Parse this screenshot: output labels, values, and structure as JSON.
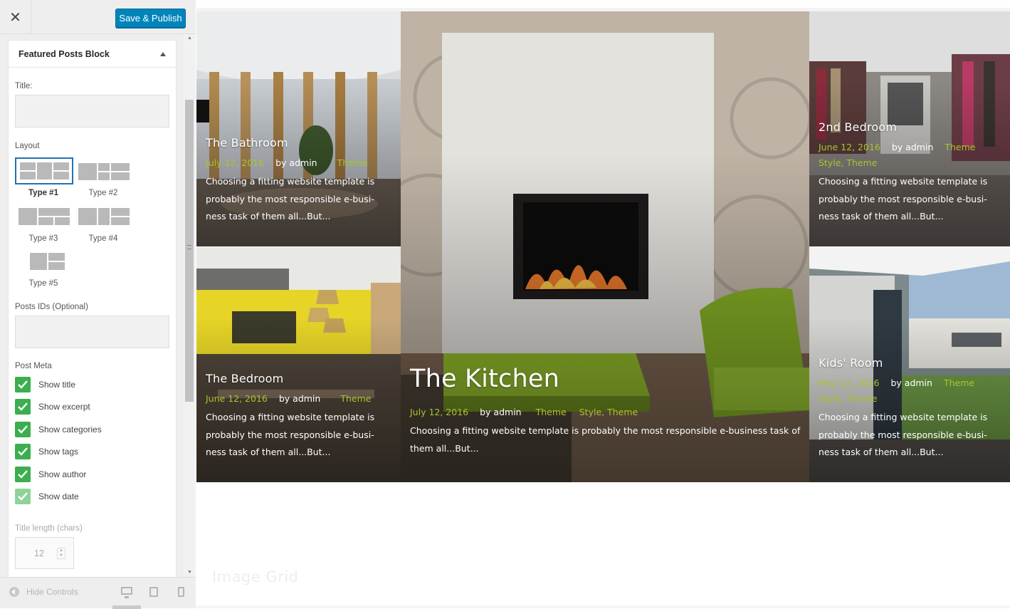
{
  "header": {
    "close_icon": "close-icon",
    "publish_label": "Save & Publish"
  },
  "widget": {
    "title": "Featured Posts Block",
    "title_label": "Title:",
    "title_value": "",
    "layout_label": "Layout",
    "layouts": [
      {
        "label": "Type #1",
        "selected": true
      },
      {
        "label": "Type #2",
        "selected": false
      },
      {
        "label": "Type #3",
        "selected": false
      },
      {
        "label": "Type #4",
        "selected": false
      },
      {
        "label": "Type #5",
        "selected": false
      }
    ],
    "posts_ids_label": "Posts IDs (Optional)",
    "posts_ids_value": "",
    "post_meta_label": "Post Meta",
    "post_meta": [
      {
        "label": "Show title",
        "checked": true
      },
      {
        "label": "Show excerpt",
        "checked": true
      },
      {
        "label": "Show categories",
        "checked": true
      },
      {
        "label": "Show tags",
        "checked": true
      },
      {
        "label": "Show author",
        "checked": true
      },
      {
        "label": "Show date",
        "checked": true
      }
    ],
    "title_length_label": "Title length (chars)",
    "title_length_value": "12"
  },
  "footer": {
    "hide_controls_label": "Hide Controls"
  },
  "posts": [
    {
      "title": "The Bathroom",
      "date": "July 12, 2016",
      "author": "by admin",
      "categories": "",
      "tags": "Theme",
      "excerpt": "Choosing a fitting website template is probably the most responsible e-busi-ness task of them all...But..."
    },
    {
      "title": "The Kitchen",
      "date": "July 12, 2016",
      "author": "by admin",
      "categories": "Theme",
      "tags": "Style, Theme",
      "excerpt": "Choosing a fitting website template is probably the most responsible e-business task of them all...But..."
    },
    {
      "title": "2nd Bedroom",
      "date": "June 12, 2016",
      "author": "by admin",
      "categories": "Theme",
      "tags": "Style, Theme",
      "excerpt": "Choosing a fitting website template is probably the most responsible e-busi-ness task of them all...But..."
    },
    {
      "title": "The Bedroom",
      "date": "June 12, 2016",
      "author": "by admin",
      "categories": "",
      "tags": "Theme",
      "excerpt": "Choosing a fitting website template is probably the most responsible e-busi-ness task of them all...But..."
    },
    {
      "title": "Kids' Room",
      "date": "May 12, 2016",
      "author": "by admin",
      "categories": "Theme",
      "tags": "Style, Theme",
      "excerpt": "Choosing a fitting website template is probably the most responsible e-busi-ness task of them all...But..."
    }
  ],
  "section_heading": "Image Grid",
  "colors": {
    "publish": "#0085ba",
    "check": "#3cae4f",
    "meta_accent": "#a9c42b"
  }
}
